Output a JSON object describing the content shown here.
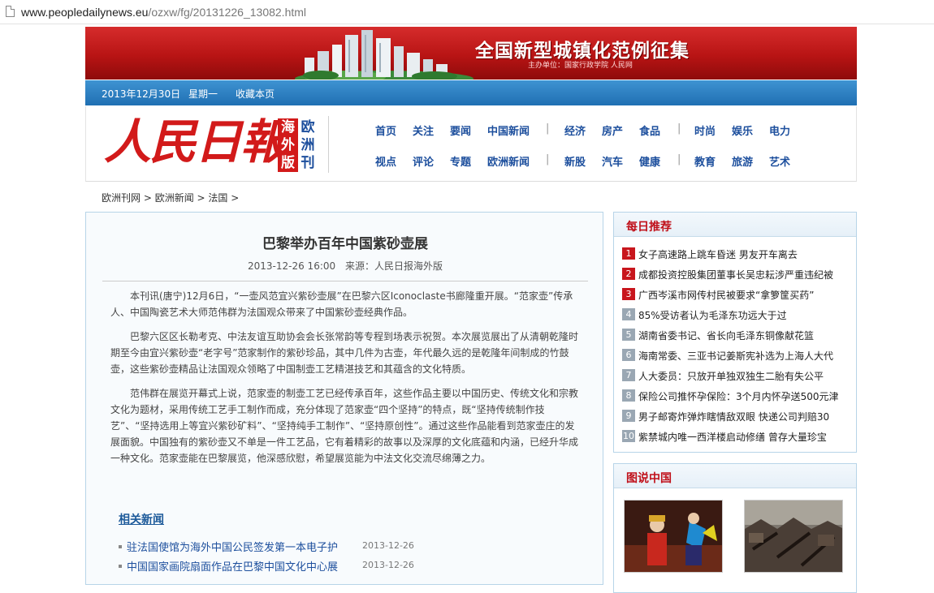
{
  "browser": {
    "url_host": "www.peopledailynews.eu",
    "url_path": "/ozxw/fg/20131226_13082.html"
  },
  "banner": {
    "title": "全国新型城镇化范例征集",
    "subtitle": "主办单位：国家行政学院 人民网"
  },
  "datebar": {
    "date": "2013年12月30日",
    "weekday": "星期一",
    "bookmark": "收藏本页"
  },
  "logo": {
    "main": "人民日報",
    "box": [
      "海",
      "外",
      "版"
    ],
    "edition": [
      "欧",
      "洲",
      "刊"
    ]
  },
  "nav": {
    "row1": [
      "首页",
      "关注",
      "要闻",
      "中国新闻",
      "|",
      "经济",
      "房产",
      "食品",
      "|",
      "时尚",
      "娱乐",
      "电力"
    ],
    "row2": [
      "视点",
      "评论",
      "专题",
      "欧洲新闻",
      "|",
      "新股",
      "汽车",
      "健康",
      "|",
      "教育",
      "旅游",
      "艺术"
    ]
  },
  "breadcrumb": [
    "欧洲刊网",
    " > ",
    "欧洲新闻",
    " > ",
    "法国",
    " >"
  ],
  "article": {
    "title": "巴黎举办百年中国紫砂壶展",
    "datetime": "2013-12-26 16:00",
    "source": "来源：人民日报海外版",
    "paragraphs": [
      "本刊讯(唐宁)12月6日，“一壶风范宜兴紫砂壶展”在巴黎六区Iconoclaste书廊隆重开展。“范家壶”传承人、中国陶瓷艺术大师范伟群为法国观众带来了中国紫砂壶经典作品。",
      "巴黎六区区长勒考克、中法友谊互助协会会长张常韵等专程到场表示祝贺。本次展览展出了从清朝乾隆时期至今由宜兴紫砂壶“老字号”范家制作的紫砂珍品，其中几件为古壶，年代最久远的是乾隆年间制成的竹鼓壶，这些紫砂壶精品让法国观众领略了中国制壶工艺精湛技艺和其蕴含的文化特质。",
      "范伟群在展览开幕式上说，范家壶的制壶工艺已经传承百年，这些作品主要以中国历史、传统文化和宗教文化为题材，采用传统工艺手工制作而成，充分体现了范家壶“四个坚持”的特点，既“坚持传统制作技艺”、“坚持选用上等宜兴紫砂矿料”、“坚持纯手工制作”、“坚持原创性”。通过这些作品能看到范家壶庄的发展面貌。中国独有的紫砂壶又不单是一件工艺品，它有着精彩的故事以及深厚的文化底蕴和内涵，已经升华成一种文化。范家壶能在巴黎展览，他深感欣慰，希望展览能为中法文化交流尽绵薄之力。"
    ]
  },
  "related": {
    "heading": "相关新闻",
    "items": [
      {
        "title": "驻法国使馆为海外中国公民签发第一本电子护",
        "date": "2013-12-26"
      },
      {
        "title": "中国国家画院扇面作品在巴黎中国文化中心展",
        "date": "2013-12-26"
      }
    ]
  },
  "picks": {
    "heading": "每日推荐",
    "items": [
      {
        "num": "1",
        "text": "女子高速路上跳车昏迷 男友开车离去"
      },
      {
        "num": "2",
        "text": "成都投资控股集团董事长吴忠耘涉严重违纪被"
      },
      {
        "num": "3",
        "text": "广西岑溪市网传村民被要求“拿箩筐买药”"
      },
      {
        "num": "4",
        "text": "85%受访者认为毛泽东功远大于过"
      },
      {
        "num": "5",
        "text": "湖南省委书记、省长向毛泽东铜像献花篮"
      },
      {
        "num": "6",
        "text": "海南常委、三亚书记姜斯宪补选为上海人大代"
      },
      {
        "num": "7",
        "text": "人大委员：只放开单独双独生二胎有失公平"
      },
      {
        "num": "8",
        "text": "保险公司推怀孕保险：3个月内怀孕送500元津"
      },
      {
        "num": "9",
        "text": "男子邮寄炸弹炸瞎情敌双眼 快递公司判赔30"
      },
      {
        "num": "10",
        "text": "紫禁城内唯一西洋楼启动修缮 曾存大量珍宝"
      }
    ]
  },
  "pictures": {
    "heading": "图说中国"
  },
  "colors": {
    "banner_red": "#b81414",
    "datebar_blue": "#1f6fb3",
    "nav_blue": "#1d4f9d",
    "hot_red": "#c8161d"
  }
}
